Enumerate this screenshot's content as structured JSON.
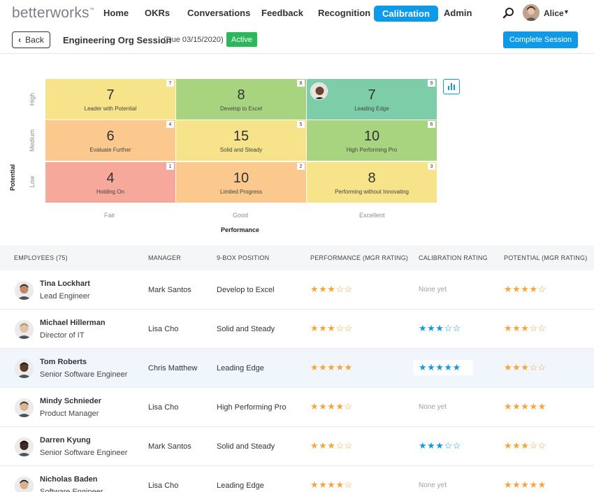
{
  "nav": {
    "logo": "betterworks",
    "logo_mark": "™",
    "items": [
      "Home",
      "OKRs",
      "Conversations",
      "Feedback",
      "Recognition",
      "Calibration",
      "Admin"
    ],
    "active_item": "Calibration",
    "user_name": "Alice"
  },
  "subheader": {
    "back_label": "Back",
    "session_title": "Engineering Org Session",
    "due": "(Due 03/15/2020)",
    "status_badge": "Active",
    "complete_label": "Complete Session"
  },
  "ninebox": {
    "y_axis_label": "Potential",
    "x_axis_label": "Performance",
    "row_labels": [
      "High",
      "Medium",
      "Low"
    ],
    "col_labels": [
      "Fair",
      "Good",
      "Excellent"
    ],
    "cells": [
      {
        "count": "7",
        "label": "Leader with Potential",
        "box": "7",
        "color": "#f6e38a"
      },
      {
        "count": "8",
        "label": "Develop to Excel",
        "box": "8",
        "color": "#a9d47f"
      },
      {
        "count": "7",
        "label": "Leading Edge",
        "box": "9",
        "color": "#7ecda9"
      },
      {
        "count": "6",
        "label": "Evaluate Further",
        "box": "4",
        "color": "#fbc98d"
      },
      {
        "count": "15",
        "label": "Solid and Steady",
        "box": "5",
        "color": "#f6e38a"
      },
      {
        "count": "10",
        "label": "High Performing Pro",
        "box": "6",
        "color": "#a9d47f"
      },
      {
        "count": "4",
        "label": "Holding On",
        "box": "1",
        "color": "#f6a99a"
      },
      {
        "count": "10",
        "label": "Limited Progress",
        "box": "2",
        "color": "#fbc98d"
      },
      {
        "count": "8",
        "label": "Performing without Innovating",
        "box": "3",
        "color": "#f6e38a"
      }
    ]
  },
  "table": {
    "headers": [
      "EMPLOYEES (75)",
      "MANAGER",
      "9-BOX POSITION",
      "PERFORMANCE (MGR RATING)",
      "CALIBRATION RATING",
      "POTENTIAL (MGR RATING)"
    ],
    "none_text": "None yet",
    "rows": [
      {
        "name": "Tina Lockhart",
        "title": "Lead Engineer",
        "manager": "Mark Santos",
        "position": "Develop to Excel",
        "performance": 3,
        "calibration": null,
        "potential": 4
      },
      {
        "name": "Michael Hillerman",
        "title": "Director of IT",
        "manager": "Lisa Cho",
        "position": "Solid and Steady",
        "performance": 3,
        "calibration": 3,
        "potential": 3
      },
      {
        "name": "Tom Roberts",
        "title": "Senior Software Engineer",
        "manager": "Chris Matthew",
        "position": "Leading Edge",
        "performance": 5,
        "calibration": 5,
        "potential": 3
      },
      {
        "name": "Mindy Schnieder",
        "title": "Product Manager",
        "manager": "Lisa Cho",
        "position": "High Performing Pro",
        "performance": 4,
        "calibration": null,
        "potential": 5
      },
      {
        "name": "Darren Kyung",
        "title": "Senior Software Engineer",
        "manager": "Mark Santos",
        "position": "Solid and Steady",
        "performance": 3,
        "calibration": 3,
        "potential": 3
      },
      {
        "name": "Nicholas Baden",
        "title": "Software Engineer",
        "manager": "Lisa Cho",
        "position": "Leading Edge",
        "performance": 4,
        "calibration": null,
        "potential": 5
      }
    ]
  }
}
